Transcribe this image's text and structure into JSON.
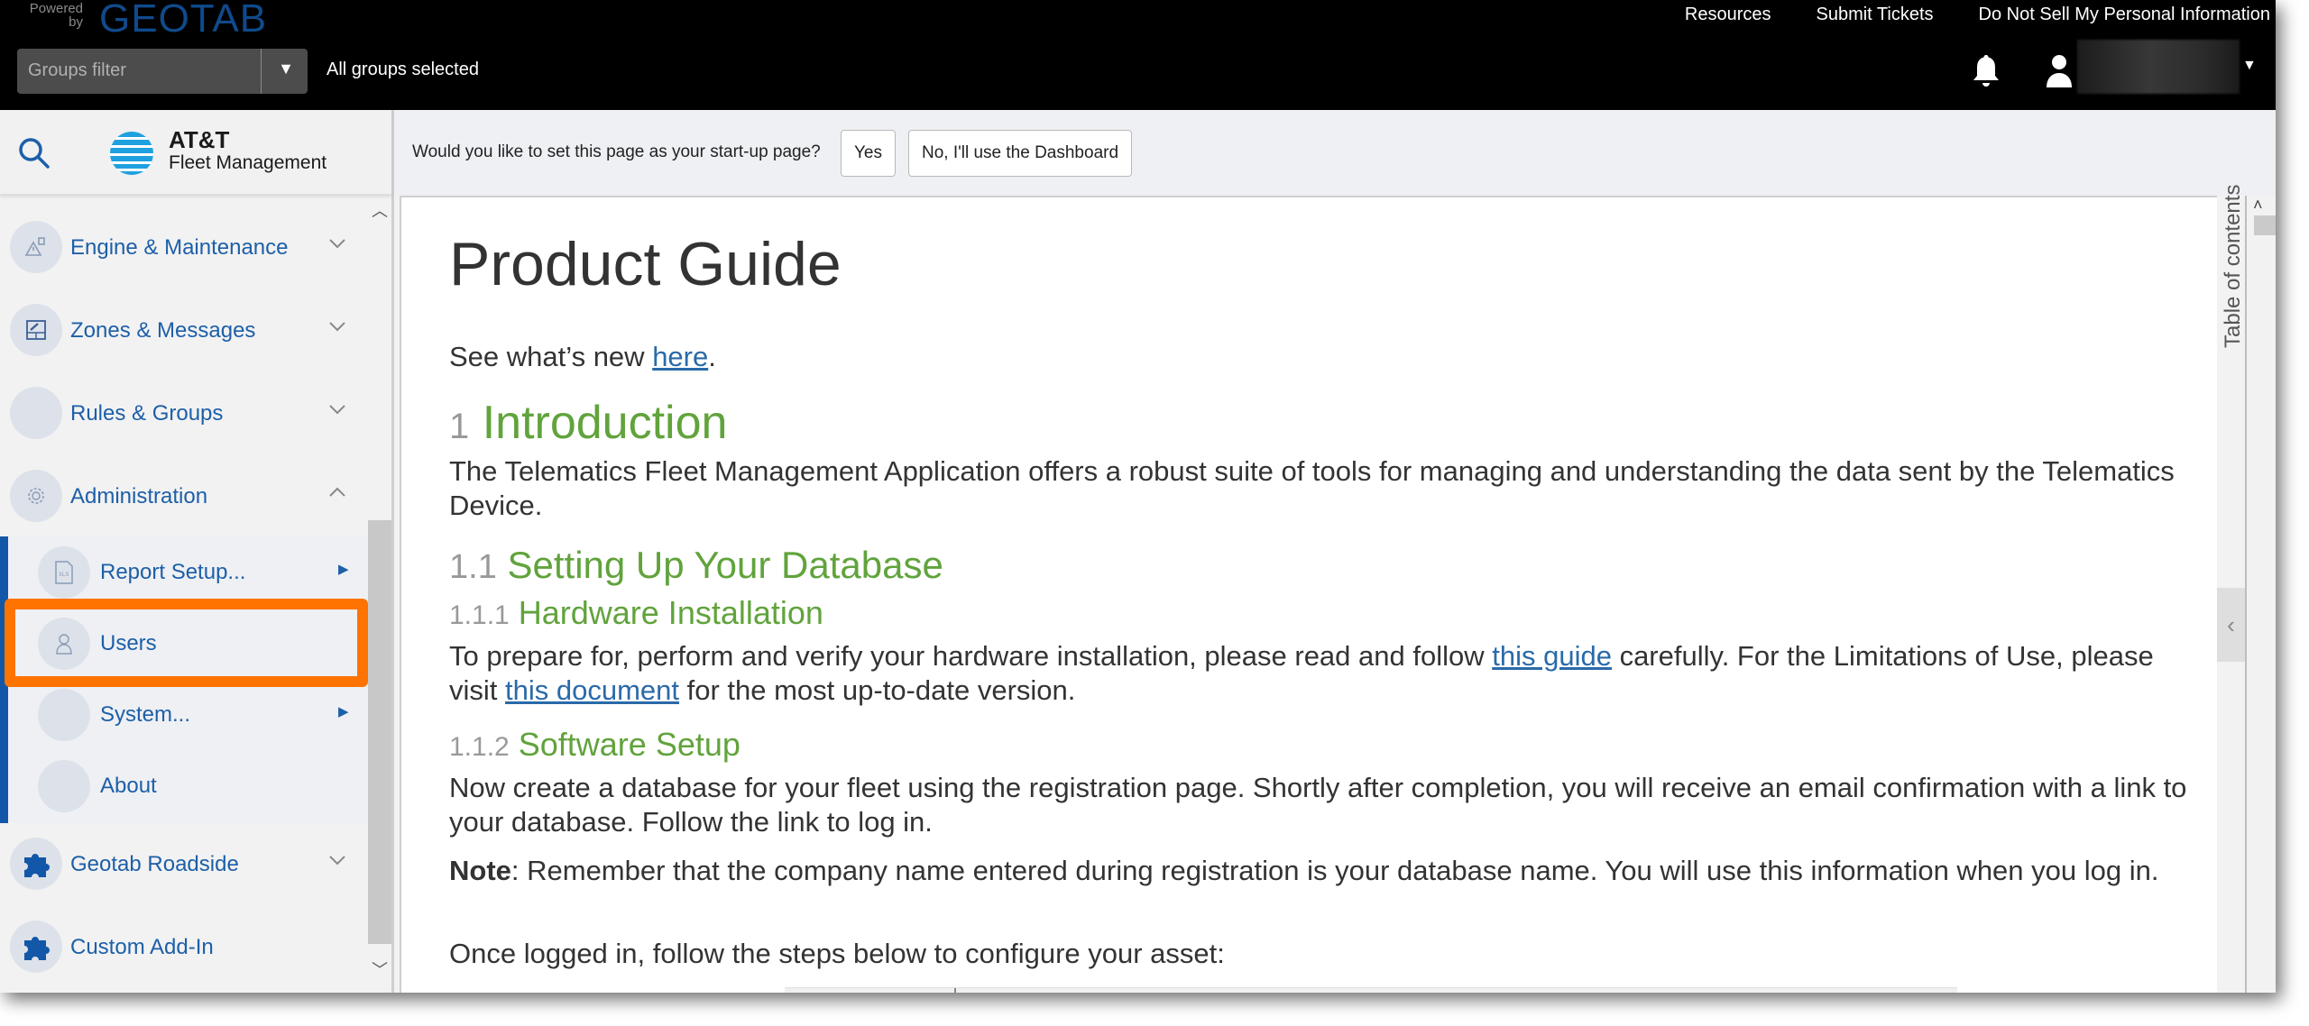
{
  "header": {
    "powered_by": "Powered by",
    "brand": "GEOTAB",
    "groups_filter_placeholder": "Groups filter",
    "groups_status": "All groups selected",
    "links": [
      "Resources",
      "Submit Tickets",
      "Do Not Sell My Personal Information"
    ],
    "icons": {
      "notifications": "bell-icon",
      "user": "user-icon",
      "user_menu": "caret-down-icon"
    },
    "user_name_redacted": true
  },
  "sidebar": {
    "logo_title": "AT&T",
    "logo_subtitle": "Fleet Management",
    "search_icon": "search-icon",
    "items": [
      {
        "label": "Engine & Maintenance",
        "icon": "engine-maintenance-icon",
        "expanded": false
      },
      {
        "label": "Zones & Messages",
        "icon": "zones-messages-icon",
        "expanded": false
      },
      {
        "label": "Rules & Groups",
        "icon": "rules-groups-icon",
        "expanded": false
      },
      {
        "label": "Administration",
        "icon": "gear-icon",
        "expanded": true,
        "children": [
          {
            "label": "Report Setup...",
            "icon": "xls-file-icon",
            "has_submenu": true
          },
          {
            "label": "Users",
            "icon": "user-outline-icon",
            "has_submenu": false,
            "highlighted": true
          },
          {
            "label": "System...",
            "icon": "",
            "has_submenu": true
          },
          {
            "label": "About",
            "icon": "",
            "has_submenu": false
          }
        ]
      },
      {
        "label": "Geotab Roadside",
        "icon": "puzzle-icon",
        "expanded": false
      },
      {
        "label": "Custom Add-In",
        "icon": "puzzle-icon",
        "expanded": null
      }
    ]
  },
  "startup_prompt": {
    "question": "Would you like to set this page as your start-up page?",
    "yes_label": "Yes",
    "no_label": "No, I'll use the Dashboard"
  },
  "document": {
    "title": "Product Guide",
    "whats_new_prefix": "See what’s new ",
    "whats_new_link": "here",
    "whats_new_suffix": ".",
    "sections": [
      {
        "number": "1",
        "title": "Introduction"
      },
      {
        "number": "1.1",
        "title": "Setting Up Your Database"
      },
      {
        "number": "1.1.1",
        "title": "Hardware Installation"
      },
      {
        "number": "1.1.2",
        "title": "Software Setup"
      }
    ],
    "intro_text": "The Telematics Fleet Management Application offers a robust suite of tools for managing and understanding the data sent by the Telematics Device.",
    "hardware_text_1": "To prepare for, perform and verify your hardware installation, please read and follow ",
    "hardware_link_1": "this guide",
    "hardware_text_2": " carefully. For the Limitations of Use, please visit ",
    "hardware_link_2": "this document",
    "hardware_text_3": " for the most up-to-date version.",
    "software_text": "Now create a database for your fleet using the registration page. Shortly after completion, you will receive an email confirmation with a link to your database. Follow the link to log in.",
    "note_label": "Note",
    "note_text": ": Remember that the company name entered during registration is your database name. You will use this information when you log in.",
    "steps_intro": "Once logged in, follow the steps below to configure your asset:"
  },
  "toc": {
    "label": "Table of contents"
  },
  "colors": {
    "header_bg": "#000000",
    "brand_blue": "#0f4a8c",
    "nav_text": "#1d5fa8",
    "heading_green": "#61a33c",
    "link": "#2a6aa8",
    "highlight": "#ff7300"
  }
}
